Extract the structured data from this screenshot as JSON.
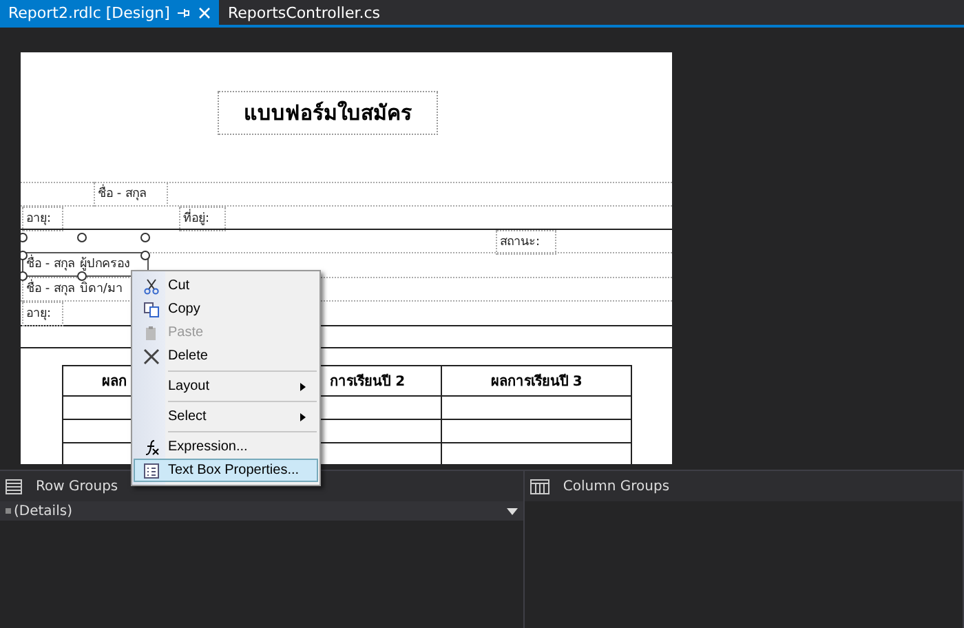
{
  "tabs": [
    {
      "label": "Report2.rdlc [Design]",
      "selected": true
    },
    {
      "label": "ReportsController.cs",
      "selected": false
    }
  ],
  "report": {
    "title": "แบบฟอร์มใบสมัคร",
    "fields": [
      {
        "label": "ชื่อ - สกุล",
        "selected": false
      },
      {
        "label": "อายุ:",
        "selected": false
      },
      {
        "label": "ที่อยู่:",
        "selected": false
      },
      {
        "label": "สถานะ:",
        "selected": false
      },
      {
        "label": "ชื่อ - สกุล ผู้ปกครอง",
        "selected": true
      },
      {
        "label": "ชื่อ - สกุล บิดา/มา",
        "selected": false
      },
      {
        "label": "อายุ:",
        "selected": false
      }
    ],
    "table": {
      "columns": [
        "ผลก",
        "การเรียนปี 2",
        "ผลการเรียนปี 3"
      ]
    }
  },
  "context_menu": {
    "items": [
      {
        "kind": "item",
        "label": "Cut",
        "disabled": false,
        "selected": false,
        "submenu": false
      },
      {
        "kind": "item",
        "label": "Copy",
        "disabled": false,
        "selected": false,
        "submenu": false
      },
      {
        "kind": "item",
        "label": "Paste",
        "disabled": true,
        "selected": false,
        "submenu": false
      },
      {
        "kind": "item",
        "label": "Delete",
        "disabled": false,
        "selected": false,
        "submenu": false
      },
      {
        "kind": "separator"
      },
      {
        "kind": "item",
        "label": "Layout",
        "disabled": false,
        "selected": false,
        "submenu": true
      },
      {
        "kind": "separator"
      },
      {
        "kind": "item",
        "label": "Select",
        "disabled": false,
        "selected": false,
        "submenu": true
      },
      {
        "kind": "separator"
      },
      {
        "kind": "item",
        "label": "Expression...",
        "disabled": false,
        "selected": false,
        "submenu": false
      },
      {
        "kind": "item",
        "label": "Text Box Properties...",
        "disabled": false,
        "selected": true,
        "submenu": false
      }
    ]
  },
  "row_groups": {
    "title": "Row Groups",
    "items": [
      {
        "label": "(Details)"
      }
    ]
  },
  "column_groups": {
    "title": "Column Groups"
  }
}
